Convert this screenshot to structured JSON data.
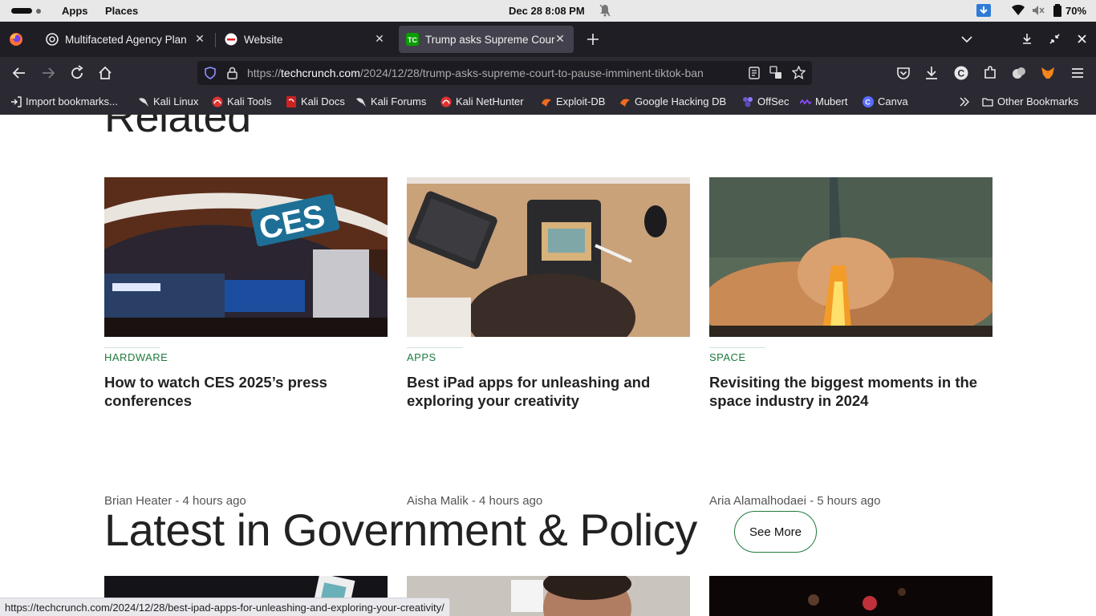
{
  "os": {
    "menus": [
      "Apps",
      "Places"
    ],
    "clock": "Dec 28   8:08 PM",
    "battery": "70%"
  },
  "tabs": [
    {
      "title": "Multifaceted Agency Plan",
      "favicon": "chatgpt-icon"
    },
    {
      "title": "Website",
      "favicon": "website-icon"
    },
    {
      "title": "Trump asks Supreme Cour",
      "favicon": "techcrunch-icon"
    }
  ],
  "url": {
    "scheme": "https://",
    "host": "techcrunch.com",
    "path": "/2024/12/28/trump-asks-supreme-court-to-pause-imminent-tiktok-ban"
  },
  "bookmarks": [
    "Import bookmarks...",
    "Kali Linux",
    "Kali Tools",
    "Kali Docs",
    "Kali Forums",
    "Kali NetHunter",
    "Exploit-DB",
    "Google Hacking DB",
    "OffSec",
    "Mubert",
    "Canva"
  ],
  "other_bookmarks": "Other Bookmarks",
  "page": {
    "related_title": "Related",
    "cards": [
      {
        "category": "HARDWARE",
        "headline": "How to watch CES 2025’s press conferences",
        "byline": "Brian Heater - 4 hours ago",
        "thumb_text": "CES"
      },
      {
        "category": "APPS",
        "headline": "Best iPad apps for unleashing and exploring your creativity",
        "byline": "Aisha Malik - 4 hours ago"
      },
      {
        "category": "SPACE",
        "headline": "Revisiting the biggest moments in the space industry in 2024",
        "byline": "Aria Alamalhodaei - 5 hours ago"
      }
    ],
    "latest_title": "Latest in Government & Policy",
    "see_more": "See More"
  },
  "status_url": "https://techcrunch.com/2024/12/28/best-ipad-apps-for-unleashing-and-exploring-your-creativity/",
  "colors": {
    "accent_green": "#1f7a3c",
    "tab_strip": "#1f1e25",
    "toolbar": "#2b2a33"
  }
}
